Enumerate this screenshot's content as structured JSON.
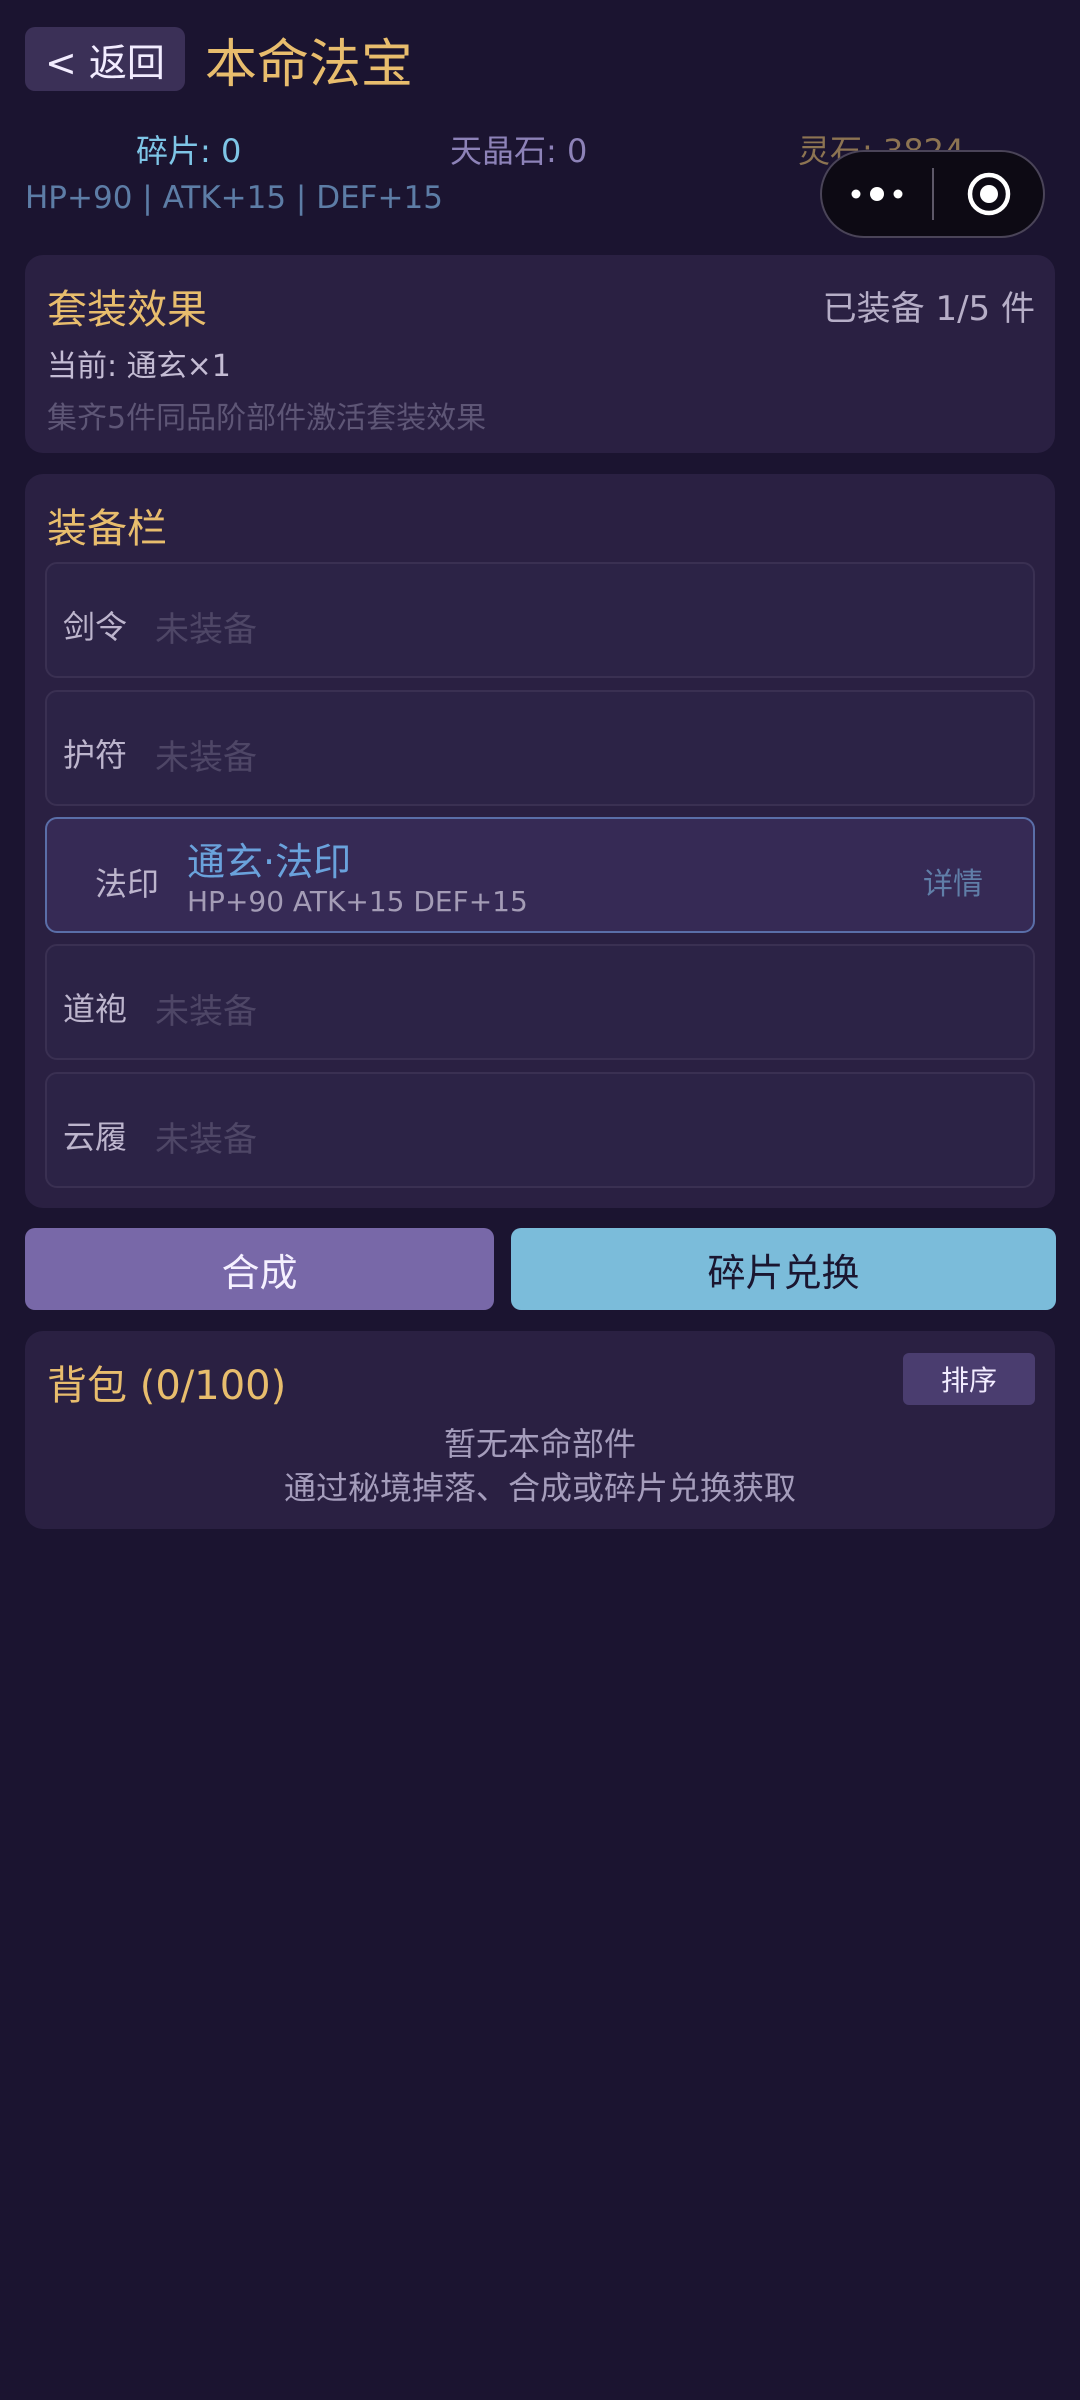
{
  "header": {
    "back_label": "< 返回",
    "title": "本命法宝"
  },
  "capsule": {
    "more_icon": "more-dots-icon",
    "close_icon": "target-icon"
  },
  "currencies": {
    "fragments": "碎片: 0",
    "sky_crystal": "天晶石: 0",
    "spirit_stone": "灵石: 3824"
  },
  "stats_line": "HP+90 | ATK+15 | DEF+15",
  "set_effect": {
    "title": "套装效果",
    "equipped_count": "已装备 1/5 件",
    "current": "当前: 通玄×1",
    "hint": "集齐5件同品阶部件激活套装效果"
  },
  "equipment": {
    "title": "装备栏",
    "slots": [
      {
        "name": "剑令",
        "state": "未装备"
      },
      {
        "name": "护符",
        "state": "未装备"
      },
      {
        "name": "法印",
        "item_name": "通玄·法印",
        "item_stats": "HP+90 ATK+15 DEF+15",
        "detail": "详情"
      },
      {
        "name": "道袍",
        "state": "未装备"
      },
      {
        "name": "云履",
        "state": "未装备"
      }
    ]
  },
  "actions": {
    "synthesize": "合成",
    "exchange": "碎片兑换"
  },
  "backpack": {
    "title": "背包 (0/100)",
    "sort_label": "排序",
    "empty_line1": "暂无本命部件",
    "empty_line2": "通过秘境掉落、合成或碎片兑换获取"
  },
  "colors": {
    "background": "#1b1430",
    "card": "#2a2042",
    "accent_gold": "#e8bd6d",
    "item_blue": "#6aa2dc",
    "synth_button": "#7868a8",
    "exchange_button": "#7bbcda"
  }
}
